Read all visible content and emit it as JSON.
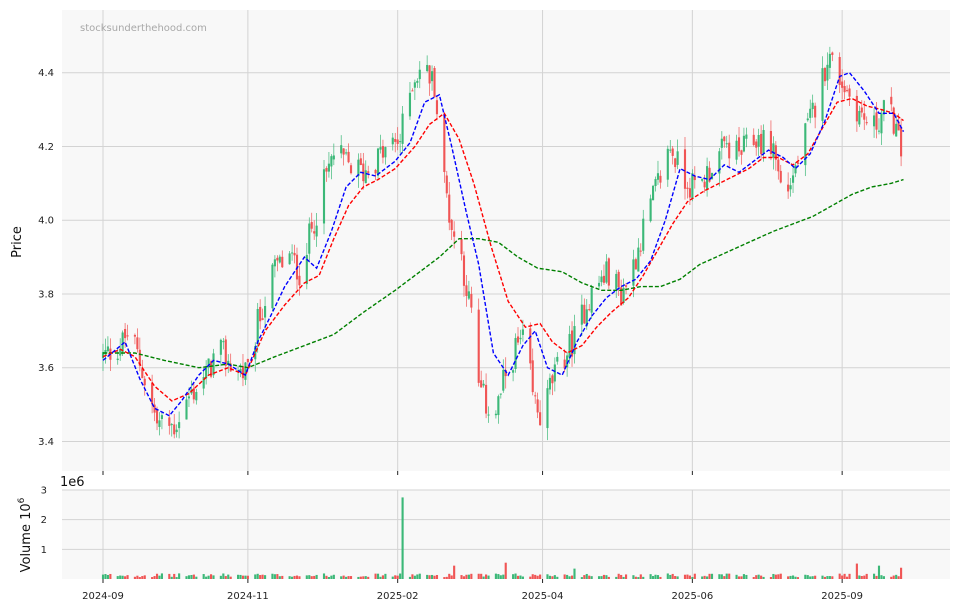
{
  "chart_data": [
    {
      "type": "candlestick",
      "watermark": "stocksunderthehood.com",
      "ylabel": "Price",
      "ylim": [
        3.32,
        4.57
      ],
      "yticks": [
        "3.4",
        "3.6",
        "3.8",
        "4.0",
        "4.2",
        "4.4"
      ],
      "grid": true,
      "colors": {
        "up": "#3cb878",
        "down": "#f05555",
        "ma_short": "#0000ff",
        "ma_mid": "#ff0000",
        "ma_long": "#008000",
        "panel_bg": "#f8f8f8"
      },
      "anchors": [
        [
          "2024-09-03",
          3.63
        ],
        [
          "2024-09-10",
          3.66
        ],
        [
          "2024-09-14",
          3.7
        ],
        [
          "2024-09-20",
          3.57
        ],
        [
          "2024-09-25",
          3.45
        ],
        [
          "2024-10-02",
          3.44
        ],
        [
          "2024-10-08",
          3.52
        ],
        [
          "2024-10-15",
          3.58
        ],
        [
          "2024-10-20",
          3.65
        ],
        [
          "2024-10-26",
          3.6
        ],
        [
          "2024-11-01",
          3.58
        ],
        [
          "2024-11-05",
          3.72
        ],
        [
          "2024-11-12",
          3.87
        ],
        [
          "2024-11-18",
          3.9
        ],
        [
          "2024-11-22",
          3.86
        ],
        [
          "2024-11-28",
          4.0
        ],
        [
          "2024-12-02",
          4.1
        ],
        [
          "2024-12-06",
          4.18
        ],
        [
          "2024-12-12",
          4.15
        ],
        [
          "2024-12-18",
          4.13
        ],
        [
          "2024-12-24",
          4.17
        ],
        [
          "2025-01-02",
          4.22
        ],
        [
          "2025-01-07",
          4.38
        ],
        [
          "2025-01-11",
          4.42
        ],
        [
          "2025-01-16",
          4.37
        ],
        [
          "2025-01-19",
          4.15
        ],
        [
          "2025-01-23",
          3.98
        ],
        [
          "2025-01-27",
          3.9
        ],
        [
          "2025-01-31",
          3.74
        ],
        [
          "2025-02-03",
          3.55
        ],
        [
          "2025-02-06",
          3.5
        ],
        [
          "2025-02-10",
          3.48
        ],
        [
          "2025-02-14",
          3.58
        ],
        [
          "2025-02-18",
          3.65
        ],
        [
          "2025-02-22",
          3.68
        ],
        [
          "2025-02-25",
          3.52
        ],
        [
          "2025-03-01",
          3.45
        ],
        [
          "2025-03-04",
          3.55
        ],
        [
          "2025-03-09",
          3.62
        ],
        [
          "2025-03-14",
          3.68
        ],
        [
          "2025-03-19",
          3.78
        ],
        [
          "2025-03-25",
          3.84
        ],
        [
          "2025-03-28",
          3.86
        ],
        [
          "2025-04-02",
          3.8
        ],
        [
          "2025-04-07",
          3.88
        ],
        [
          "2025-04-12",
          4.0
        ],
        [
          "2025-04-17",
          4.1
        ],
        [
          "2025-04-22",
          4.2
        ],
        [
          "2025-04-27",
          4.12
        ],
        [
          "2025-05-03",
          4.08
        ],
        [
          "2025-05-09",
          4.15
        ],
        [
          "2025-05-15",
          4.2
        ],
        [
          "2025-05-20",
          4.18
        ],
        [
          "2025-05-27",
          4.22
        ],
        [
          "2025-06-03",
          4.2
        ],
        [
          "2025-06-07",
          4.06
        ],
        [
          "2025-06-11",
          4.12
        ],
        [
          "2025-06-17",
          4.25
        ],
        [
          "2025-06-22",
          4.35
        ],
        [
          "2025-06-25",
          4.45
        ],
        [
          "2025-06-29",
          4.4
        ],
        [
          "2025-07-04",
          4.34
        ],
        [
          "2025-07-09",
          4.28
        ],
        [
          "2025-07-14",
          4.25
        ],
        [
          "2025-07-18",
          4.3
        ],
        [
          "2025-07-22",
          4.27
        ],
        [
          "2025-07-26",
          4.15
        ]
      ],
      "ma_short": [
        [
          "2024-09-03",
          3.62
        ],
        [
          "2024-09-12",
          3.67
        ],
        [
          "2024-09-18",
          3.57
        ],
        [
          "2024-09-24",
          3.49
        ],
        [
          "2024-09-30",
          3.47
        ],
        [
          "2024-10-05",
          3.51
        ],
        [
          "2024-10-12",
          3.58
        ],
        [
          "2024-10-18",
          3.62
        ],
        [
          "2024-10-24",
          3.61
        ],
        [
          "2024-10-31",
          3.58
        ],
        [
          "2024-11-05",
          3.67
        ],
        [
          "2024-11-11",
          3.75
        ],
        [
          "2024-11-16",
          3.82
        ],
        [
          "2024-11-20",
          3.86
        ],
        [
          "2024-11-24",
          3.9
        ],
        [
          "2024-11-29",
          3.87
        ],
        [
          "2024-12-05",
          3.97
        ],
        [
          "2024-12-11",
          4.09
        ],
        [
          "2024-12-17",
          4.13
        ],
        [
          "2024-12-23",
          4.12
        ],
        [
          "2024-12-31",
          4.16
        ],
        [
          "2025-01-06",
          4.21
        ],
        [
          "2025-01-12",
          4.32
        ],
        [
          "2025-01-18",
          4.34
        ],
        [
          "2025-01-23",
          4.2
        ],
        [
          "2025-01-29",
          4.02
        ],
        [
          "2025-02-03",
          3.88
        ],
        [
          "2025-02-09",
          3.64
        ],
        [
          "2025-02-15",
          3.58
        ],
        [
          "2025-02-21",
          3.66
        ],
        [
          "2025-02-26",
          3.7
        ],
        [
          "2025-03-03",
          3.6
        ],
        [
          "2025-03-09",
          3.58
        ],
        [
          "2025-03-15",
          3.67
        ],
        [
          "2025-03-21",
          3.74
        ],
        [
          "2025-03-27",
          3.79
        ],
        [
          "2025-04-02",
          3.82
        ],
        [
          "2025-04-08",
          3.84
        ],
        [
          "2025-04-14",
          3.89
        ],
        [
          "2025-04-20",
          4.0
        ],
        [
          "2025-04-26",
          4.14
        ],
        [
          "2025-05-02",
          4.12
        ],
        [
          "2025-05-08",
          4.11
        ],
        [
          "2025-05-14",
          4.15
        ],
        [
          "2025-05-20",
          4.13
        ],
        [
          "2025-05-26",
          4.16
        ],
        [
          "2025-06-01",
          4.19
        ],
        [
          "2025-06-07",
          4.17
        ],
        [
          "2025-06-12",
          4.14
        ],
        [
          "2025-06-18",
          4.18
        ],
        [
          "2025-06-24",
          4.27
        ],
        [
          "2025-06-30",
          4.39
        ],
        [
          "2025-07-04",
          4.4
        ],
        [
          "2025-07-10",
          4.35
        ],
        [
          "2025-07-16",
          4.29
        ],
        [
          "2025-07-22",
          4.29
        ],
        [
          "2025-07-26",
          4.24
        ]
      ],
      "ma_mid": [
        [
          "2024-09-03",
          3.63
        ],
        [
          "2024-09-10",
          3.65
        ],
        [
          "2024-09-16",
          3.63
        ],
        [
          "2024-09-24",
          3.55
        ],
        [
          "2024-10-01",
          3.51
        ],
        [
          "2024-10-08",
          3.53
        ],
        [
          "2024-10-16",
          3.58
        ],
        [
          "2024-10-24",
          3.6
        ],
        [
          "2024-10-31",
          3.58
        ],
        [
          "2024-11-08",
          3.7
        ],
        [
          "2024-11-16",
          3.77
        ],
        [
          "2024-11-24",
          3.83
        ],
        [
          "2024-11-30",
          3.85
        ],
        [
          "2024-12-06",
          3.95
        ],
        [
          "2024-12-12",
          4.04
        ],
        [
          "2024-12-18",
          4.09
        ],
        [
          "2024-12-24",
          4.11
        ],
        [
          "2024-12-31",
          4.14
        ],
        [
          "2025-01-08",
          4.2
        ],
        [
          "2025-01-14",
          4.26
        ],
        [
          "2025-01-20",
          4.29
        ],
        [
          "2025-01-26",
          4.22
        ],
        [
          "2025-02-01",
          4.1
        ],
        [
          "2025-02-08",
          3.93
        ],
        [
          "2025-02-15",
          3.78
        ],
        [
          "2025-02-22",
          3.71
        ],
        [
          "2025-02-28",
          3.72
        ],
        [
          "2025-03-05",
          3.67
        ],
        [
          "2025-03-11",
          3.64
        ],
        [
          "2025-03-17",
          3.66
        ],
        [
          "2025-03-23",
          3.71
        ],
        [
          "2025-03-29",
          3.75
        ],
        [
          "2025-04-05",
          3.79
        ],
        [
          "2025-04-11",
          3.85
        ],
        [
          "2025-04-17",
          3.92
        ],
        [
          "2025-04-23",
          3.99
        ],
        [
          "2025-04-29",
          4.05
        ],
        [
          "2025-05-06",
          4.08
        ],
        [
          "2025-05-12",
          4.1
        ],
        [
          "2025-05-18",
          4.12
        ],
        [
          "2025-05-24",
          4.14
        ],
        [
          "2025-05-30",
          4.17
        ],
        [
          "2025-06-05",
          4.17
        ],
        [
          "2025-06-11",
          4.15
        ],
        [
          "2025-06-17",
          4.18
        ],
        [
          "2025-06-23",
          4.25
        ],
        [
          "2025-06-29",
          4.32
        ],
        [
          "2025-07-05",
          4.33
        ],
        [
          "2025-07-11",
          4.31
        ],
        [
          "2025-07-17",
          4.3
        ],
        [
          "2025-07-22",
          4.29
        ],
        [
          "2025-07-26",
          4.27
        ]
      ],
      "ma_long": [
        [
          "2024-09-03",
          3.64
        ],
        [
          "2024-09-16",
          3.64
        ],
        [
          "2024-09-28",
          3.62
        ],
        [
          "2024-10-12",
          3.6
        ],
        [
          "2024-10-24",
          3.61
        ],
        [
          "2024-11-01",
          3.6
        ],
        [
          "2024-11-12",
          3.63
        ],
        [
          "2024-11-24",
          3.66
        ],
        [
          "2024-12-06",
          3.69
        ],
        [
          "2024-12-18",
          3.75
        ],
        [
          "2024-12-31",
          3.81
        ],
        [
          "2025-01-10",
          3.86
        ],
        [
          "2025-01-18",
          3.9
        ],
        [
          "2025-01-26",
          3.95
        ],
        [
          "2025-02-03",
          3.95
        ],
        [
          "2025-02-11",
          3.94
        ],
        [
          "2025-02-19",
          3.9
        ],
        [
          "2025-02-27",
          3.87
        ],
        [
          "2025-03-09",
          3.86
        ],
        [
          "2025-03-17",
          3.83
        ],
        [
          "2025-03-25",
          3.81
        ],
        [
          "2025-04-02",
          3.81
        ],
        [
          "2025-04-10",
          3.82
        ],
        [
          "2025-04-18",
          3.82
        ],
        [
          "2025-04-26",
          3.84
        ],
        [
          "2025-05-04",
          3.88
        ],
        [
          "2025-05-14",
          3.91
        ],
        [
          "2025-05-24",
          3.94
        ],
        [
          "2025-06-03",
          3.97
        ],
        [
          "2025-06-11",
          3.99
        ],
        [
          "2025-06-19",
          4.01
        ],
        [
          "2025-06-27",
          4.04
        ],
        [
          "2025-07-05",
          4.07
        ],
        [
          "2025-07-13",
          4.09
        ],
        [
          "2025-07-21",
          4.1
        ],
        [
          "2025-07-26",
          4.11
        ]
      ]
    },
    {
      "type": "bar",
      "ylabel": "Volume",
      "ylabel_unit": "10",
      "ylabel_unit_exp": "6",
      "offset_label": "1e6",
      "ylim": [
        0,
        3
      ],
      "yticks": [
        "1",
        "2",
        "3"
      ],
      "grid": true,
      "base_volume": 0.14,
      "spikes": [
        [
          "2025-01-03",
          2.75
        ],
        [
          "2025-01-04",
          0.55
        ],
        [
          "2025-01-12",
          0.5
        ],
        [
          "2025-01-24",
          0.45
        ],
        [
          "2025-02-14",
          0.55
        ],
        [
          "2025-03-14",
          0.35
        ],
        [
          "2025-06-28",
          0.5
        ],
        [
          "2025-07-07",
          0.52
        ],
        [
          "2025-07-16",
          0.45
        ],
        [
          "2025-07-25",
          0.38
        ]
      ]
    }
  ],
  "x_axis": {
    "start": "2024-09-03",
    "end": "2025-07-27",
    "ticks": [
      {
        "date": "2024-09-03",
        "label": "2024-09"
      },
      {
        "date": "2024-11-01",
        "label": "2024-11"
      },
      {
        "date": "2025-01-01",
        "label": "2025-02"
      },
      {
        "date": "2025-03-01",
        "label": "2025-04"
      },
      {
        "date": "2025-05-01",
        "label": "2025-06"
      },
      {
        "date": "2025-07-01",
        "label": "2025-09"
      }
    ]
  }
}
